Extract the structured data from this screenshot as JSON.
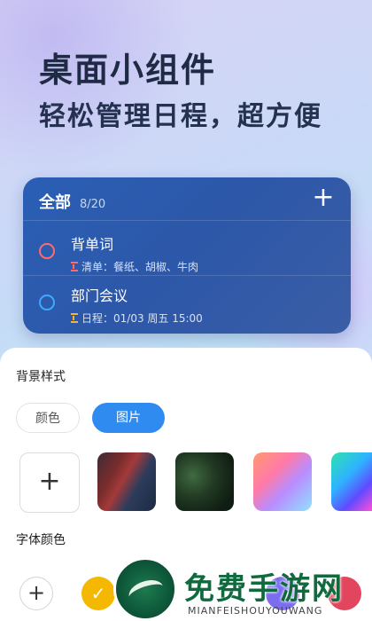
{
  "hero": {
    "headline": "桌面小组件",
    "subheadline": "轻松管理日程，超方便"
  },
  "widget": {
    "title": "全部",
    "count": "8/20",
    "add_icon": "plus-icon",
    "tasks": [
      {
        "title": "背单词",
        "meta": "清单：餐纸、胡椒、牛肉",
        "circle_color": "#ff6b6b",
        "meta_icon_color": "#ff6b6b"
      },
      {
        "title": "部门会议",
        "meta": "日程：01/03 周五 15:00",
        "circle_color": "#3fa9ff",
        "meta_icon_color": "#f3b43b"
      }
    ]
  },
  "sheet": {
    "background_section_title": "背景样式",
    "segments": [
      "颜色",
      "图片"
    ],
    "selected_segment": "图片",
    "font_color_section_title": "字体颜色",
    "add_icon": "plus-icon",
    "checkmark": "✓"
  },
  "watermark": {
    "title": "免费手游网",
    "subtitle": "MIANFEISHOUYOUWANG"
  },
  "colors": {
    "accent": "#2f8bf0",
    "widget_bg": "#2d57a8",
    "swatches": [
      "#f5b800",
      "#222222",
      "#7b6cf0",
      "#e2465e"
    ]
  }
}
